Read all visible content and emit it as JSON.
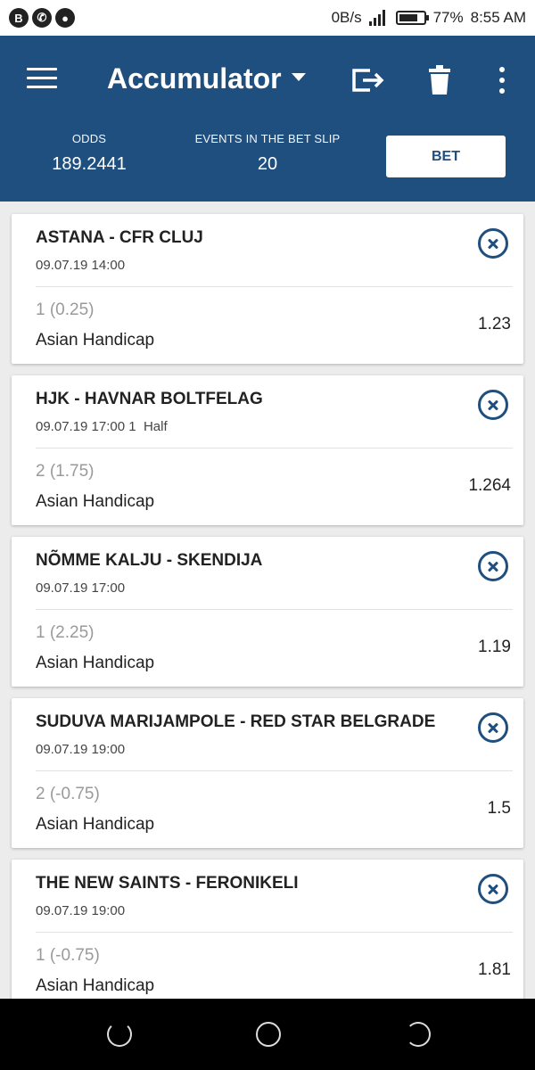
{
  "status_bar": {
    "network_speed": "0B/s",
    "battery_percent": "77%",
    "battery_level": 0.77,
    "time": "8:55 AM",
    "notification_icons": [
      "b-icon",
      "whatsapp-icon",
      "chat-icon"
    ]
  },
  "header": {
    "title": "Accumulator",
    "odds_label": "ODDS",
    "odds_value": "189.2441",
    "events_label": "EVENTS IN THE BET SLIP",
    "events_value": "20",
    "bet_label": "BET"
  },
  "colors": {
    "primary": "#1f4f7e",
    "background": "#ececec"
  },
  "bets": [
    {
      "match": "ASTANA - CFR CLUJ",
      "date": "09.07.19 14:00",
      "outcome": "1 (0.25)",
      "market": "Asian Handicap",
      "odds": "1.23"
    },
    {
      "match": "HJK - HAVNAR BOLTFELAG",
      "date": "09.07.19 17:00 1  Half",
      "outcome": "2 (1.75)",
      "market": "Asian Handicap",
      "odds": "1.264"
    },
    {
      "match": "NÕMME KALJU - SKENDIJA",
      "date": "09.07.19 17:00",
      "outcome": "1 (2.25)",
      "market": "Asian Handicap",
      "odds": "1.19"
    },
    {
      "match": "SUDUVA MARIJAMPOLE - RED STAR BELGRADE",
      "date": "09.07.19 19:00",
      "outcome": "2 (-0.75)",
      "market": "Asian Handicap",
      "odds": "1.5"
    },
    {
      "match": "THE NEW SAINTS - FERONIKELI",
      "date": "09.07.19 19:00",
      "outcome": "1 (-0.75)",
      "market": "Asian Handicap",
      "odds": "1.81"
    }
  ]
}
